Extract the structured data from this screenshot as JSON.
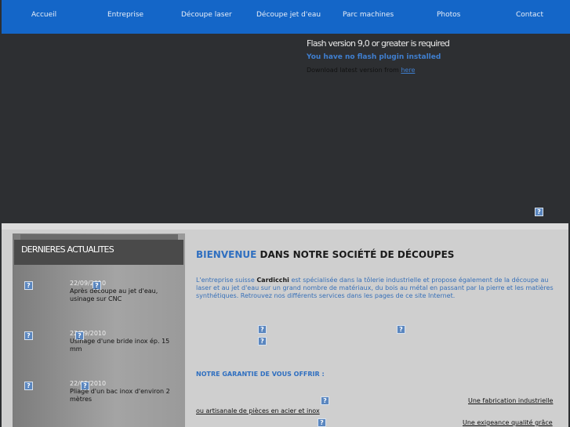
{
  "nav": {
    "items": [
      {
        "label": "Accueil"
      },
      {
        "label": "Entreprise"
      },
      {
        "label": "Découpe laser"
      },
      {
        "label": "Découpe jet d'eau"
      },
      {
        "label": "Parc machines"
      },
      {
        "label": "Photos"
      },
      {
        "label": "Contact"
      }
    ]
  },
  "flash": {
    "required": "Flash version 9,0 or greater is required",
    "no_plugin": "You have no flash plugin installed",
    "download_prefix": "Download latest version from ",
    "download_link": "here"
  },
  "placeholder_icon": "?",
  "sidebar": {
    "title": "DERNIERES ACTUALITES",
    "news": [
      {
        "date": "22/09/2010",
        "text": "Après découpe au jet d'eau, usinage sur CNC"
      },
      {
        "date": "22/09/2010",
        "text": "Usinage d'une bride inox ép. 15 mm"
      },
      {
        "date": "22/09/2010",
        "text": "Pliage d'un bac inox d'environ 2 mètres"
      }
    ]
  },
  "main": {
    "title_part1": "BIENVENUE",
    "title_part2": " DANS NOTRE SOCIÉTÉ DE DÉCOUPES",
    "intro_before": "L'entreprise suisse ",
    "intro_brand": "Cardicchi",
    "intro_after": " est spécialisée dans la tôlerie industrielle et propose également de la découpe au laser et au jet d'eau sur un grand nombre de matériaux, du bois au métal en passant par la pierre et les matières synthétiques. Retrouvez nos différents services dans les pages de ce site Internet.",
    "guarantee_title": "NOTRE GARANTIE DE VOUS OFFRIR :",
    "guarantee_1a": "Une fabrication industrielle",
    "guarantee_1b": "ou artisanale de pièces en acier et inox",
    "guarantee_2": "Une exigeance qualité grâce"
  },
  "colors": {
    "nav_bg": "#1466c8",
    "page_bg": "#2d2f32",
    "accent_blue": "#2f6fc0"
  }
}
